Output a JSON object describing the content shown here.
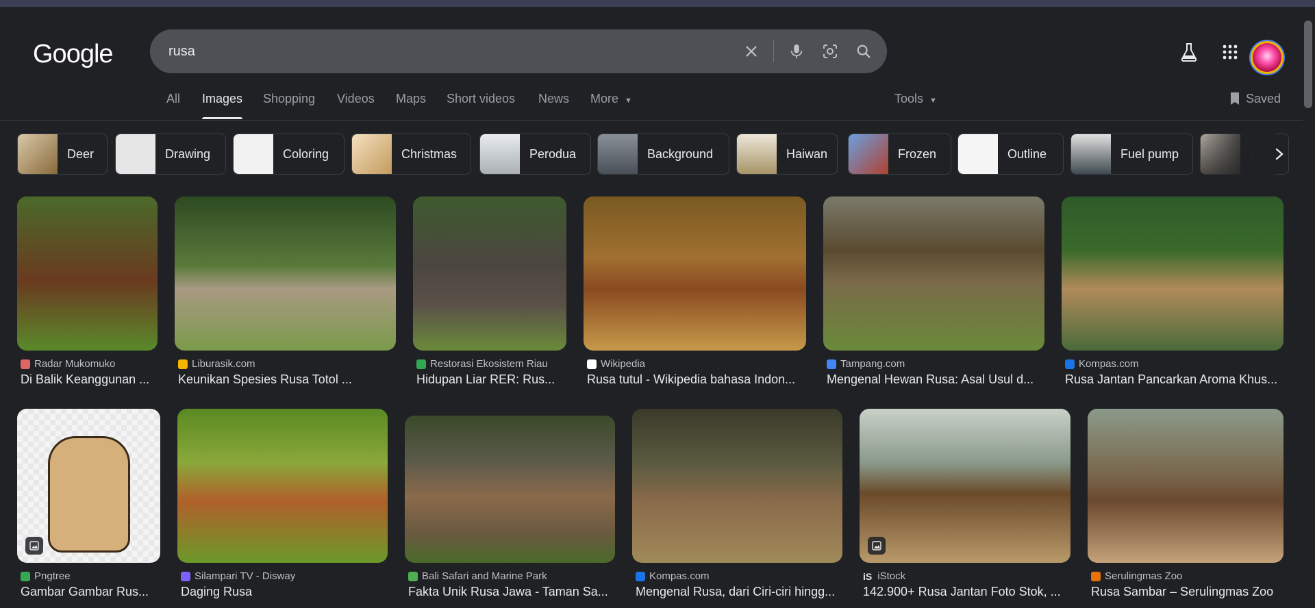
{
  "brand": {
    "logo": "Google"
  },
  "search": {
    "query": "rusa",
    "placeholder": ""
  },
  "search_icons": {
    "clear": "close-icon",
    "voice": "microphone-icon",
    "lens": "camera-lens-icon",
    "search": "search-icon"
  },
  "header_icons": {
    "labs": "flask-icon",
    "apps": "grid-icon",
    "account": "avatar"
  },
  "tabs": [
    {
      "label": "All"
    },
    {
      "label": "Images"
    },
    {
      "label": "Shopping"
    },
    {
      "label": "Videos"
    },
    {
      "label": "Maps"
    },
    {
      "label": "Short videos"
    },
    {
      "label": "News"
    },
    {
      "label": "More"
    }
  ],
  "tools": {
    "label": "Tools"
  },
  "saved": {
    "label": "Saved"
  },
  "chips": [
    {
      "label": "Deer",
      "thumb": "#8a6a3c"
    },
    {
      "label": "Drawing",
      "thumb": "#e6e6e6"
    },
    {
      "label": "Coloring",
      "thumb": "#f2f2f2"
    },
    {
      "label": "Christmas",
      "thumb": "#c49b5e"
    },
    {
      "label": "Perodua",
      "thumb": "#d9dde0"
    },
    {
      "label": "Background",
      "thumb": "#6a7078"
    },
    {
      "label": "Haiwan",
      "thumb": "#dcd6c8"
    },
    {
      "label": "Frozen",
      "thumb": "#3b6fb5"
    },
    {
      "label": "Outline",
      "thumb": "#f5f5f5"
    },
    {
      "label": "Fuel pump",
      "thumb": "#c8c8c8"
    },
    {
      "label": "C",
      "thumb": "#7e7a70"
    }
  ],
  "results_row1": [
    {
      "source": "Radar Mukomuko",
      "title": "Di Balik Keanggunan ...",
      "favicon": "#e06666",
      "img_top": "#5a7a3a",
      "img_bottom": "#7a4020"
    },
    {
      "source": "Liburasik.com",
      "title": "Keunikan Spesies Rusa Totol ...",
      "favicon": "#f4b400",
      "img_top": "#2d4a22",
      "img_bottom": "#6f8f4a"
    },
    {
      "source": "Restorasi Ekosistem Riau",
      "title": "Hidupan Liar RER: Rus...",
      "favicon": "#34a853",
      "img_top": "#3e5a2e",
      "img_bottom": "#4c4640"
    },
    {
      "source": "Wikipedia",
      "title": "Rusa tutul - Wikipedia bahasa Indon...",
      "favicon": "#ffffff",
      "img_top": "#8a6a2a",
      "img_bottom": "#c69a4a"
    },
    {
      "source": "Tampang.com",
      "title": "Mengenal Hewan Rusa: Asal Usul d...",
      "favicon": "#4285f4",
      "img_top": "#6d6a55",
      "img_bottom": "#6a8a3a"
    },
    {
      "source": "Kompas.com",
      "title": "Rusa Jantan Pancarkan Aroma Khus...",
      "favicon": "#1a73e8",
      "img_top": "#2f5a2a",
      "img_bottom": "#7a6a4a"
    }
  ],
  "results_row2": [
    {
      "source": "Pngtree",
      "title": "Gambar Gambar Rus...",
      "favicon": "#34a853",
      "img_top": "#f4f4f4",
      "img_bottom": "#d6b07a",
      "badge": "image-icon"
    },
    {
      "source": "Silampari TV - Disway",
      "title": "Daging Rusa",
      "favicon": "#7b61ff",
      "img_top": "#6b9a2a",
      "img_bottom": "#b0602a"
    },
    {
      "source": "Bali Safari and Marine Park",
      "title": "Fakta Unik Rusa Jawa - Taman Sa...",
      "favicon": "#4caf50",
      "img_top": "#3a4a2a",
      "img_bottom": "#8a6a4a"
    },
    {
      "source": "Kompas.com",
      "title": "Mengenal Rusa, dari Ciri-ciri hingg...",
      "favicon": "#1a73e8",
      "img_top": "#4a4a3a",
      "img_bottom": "#a08a5a"
    },
    {
      "source": "iStock",
      "title": "142.900+ Rusa Jantan Foto Stok, ...",
      "favicon": "#202124",
      "img_top": "#a8b0a8",
      "img_bottom": "#b89a6a",
      "badge": "image-icon"
    },
    {
      "source": "Serulingmas Zoo",
      "title": "Rusa Sambar – Serulingmas Zoo",
      "favicon": "#e8710a",
      "img_top": "#8a9a8a",
      "img_bottom": "#c4a27a"
    }
  ]
}
